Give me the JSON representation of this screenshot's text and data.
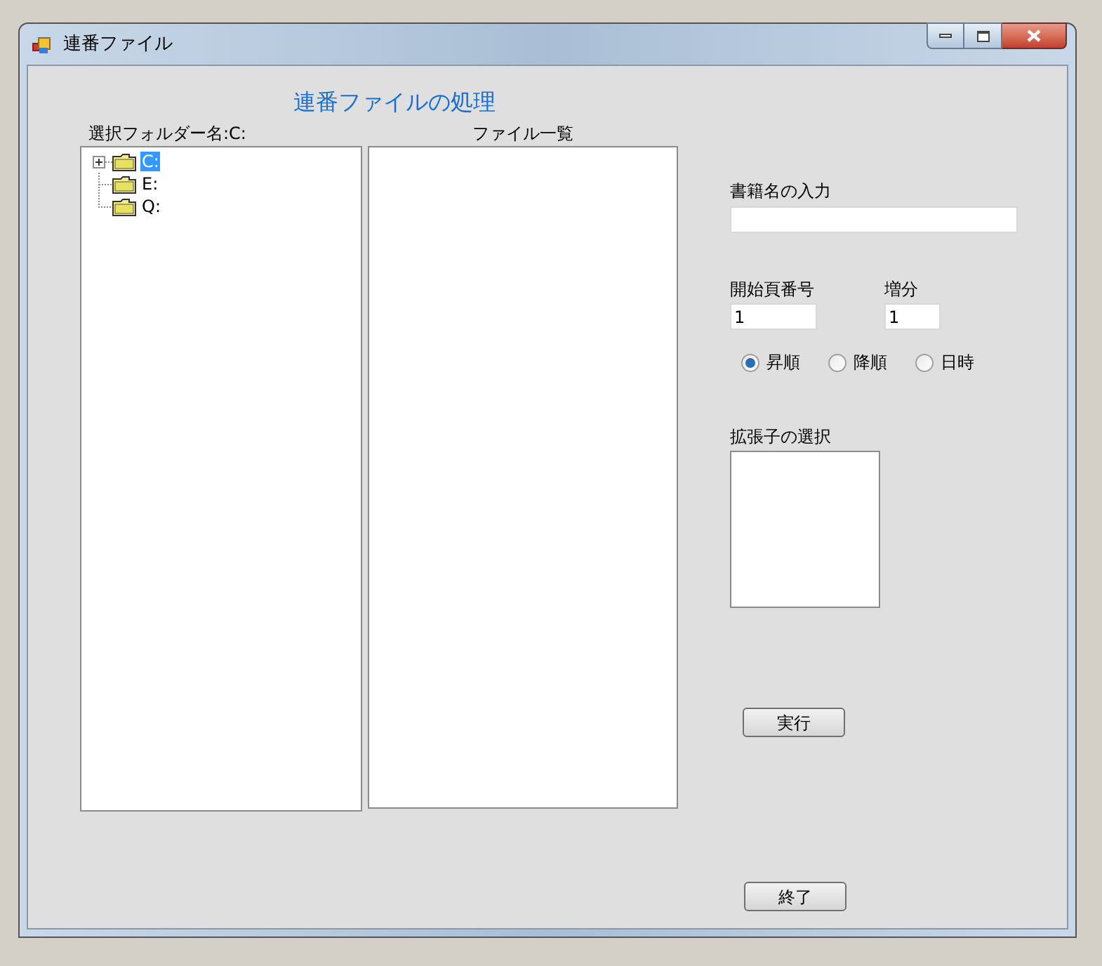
{
  "window": {
    "title": "連番ファイル"
  },
  "heading": "連番ファイルの処理",
  "folder_label": "選択フォルダー名:C:",
  "tree": [
    {
      "label": "C:",
      "kind": "collapsed",
      "selected": true
    },
    {
      "label": "E:",
      "kind": "leaf",
      "selected": false
    },
    {
      "label": "Q:",
      "kind": "leaf",
      "selected": false
    }
  ],
  "file_list": {
    "label": "ファイル一覧"
  },
  "book_name": {
    "label": "書籍名の入力"
  },
  "start_page": {
    "label": "開始頁番号",
    "value": "1"
  },
  "increment": {
    "label": "増分",
    "value": "1"
  },
  "sort_options": [
    {
      "label": "昇順",
      "selected": true
    },
    {
      "label": "降順",
      "selected": false
    },
    {
      "label": "日時",
      "selected": false
    }
  ],
  "extension": {
    "label": "拡張子の選択"
  },
  "buttons": {
    "run": "実行",
    "exit": "終了"
  }
}
